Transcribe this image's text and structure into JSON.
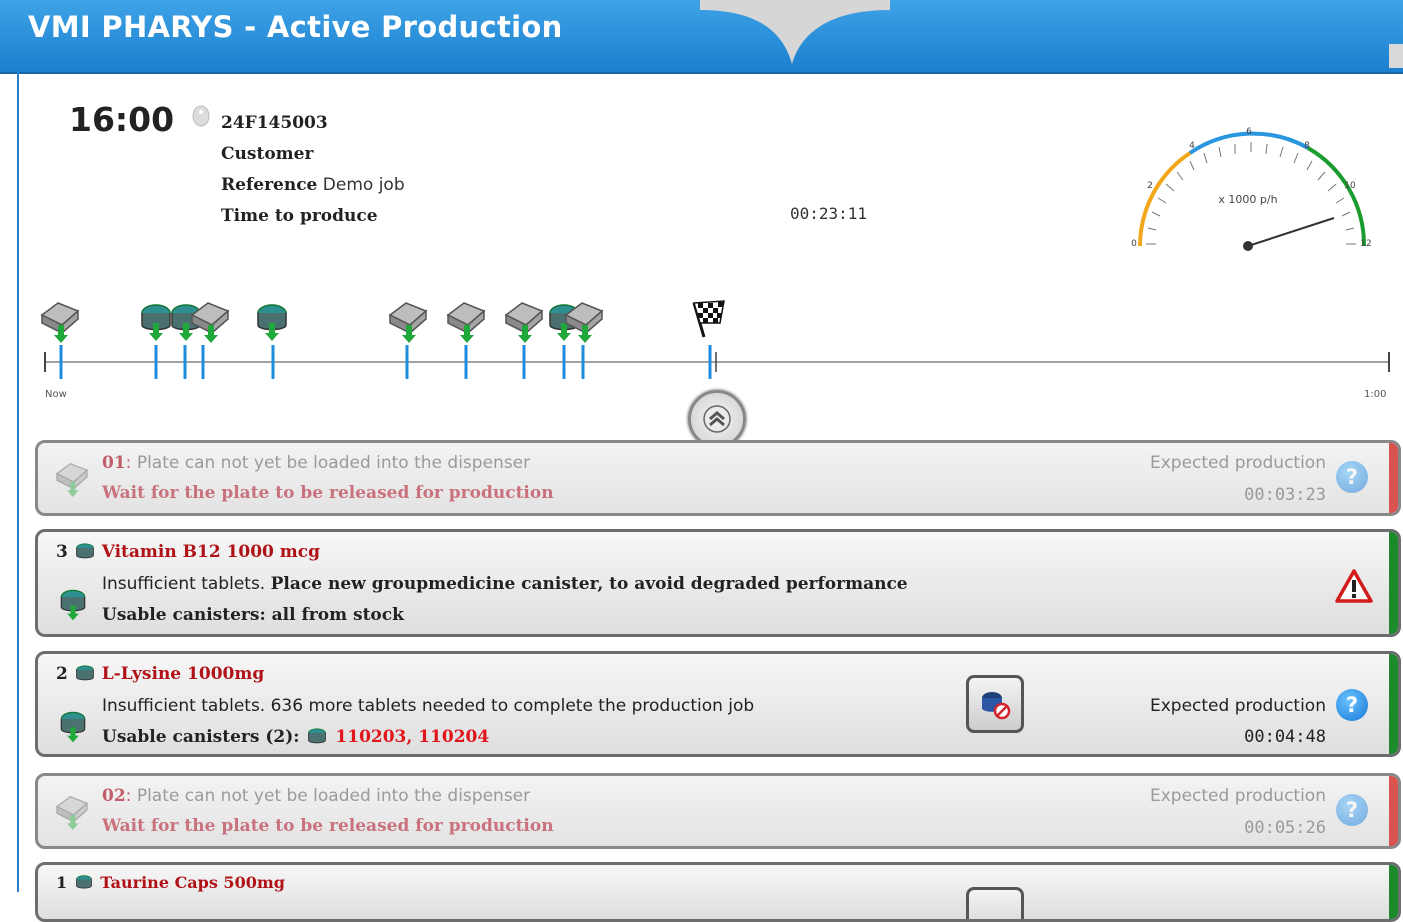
{
  "header": {
    "title": "VMI PHARYS - Active Production"
  },
  "job": {
    "clock": "16:00",
    "job_id": "24F145003",
    "customer_label": "Customer",
    "reference_label": "Reference",
    "reference_value": "Demo job",
    "time_to_produce_label": "Time to produce",
    "time_to_produce_value": "00:23:11"
  },
  "gauge": {
    "unit_label": "x 1000 p/h",
    "ticks": [
      "0",
      "2",
      "4",
      "6",
      "8",
      "10",
      "12"
    ],
    "value": 12,
    "colors": {
      "low": "#f2a61a",
      "mid": "#2b96e0",
      "high": "#1a9c2e"
    }
  },
  "timeline": {
    "start_label": "Now",
    "end_label": "1:00"
  },
  "cards": [
    {
      "number": "01",
      "line1": "Plate  can not yet be loaded into the dispenser",
      "line2": "Wait for the plate to be released for production",
      "expected_label": "Expected production",
      "expected_time": "00:03:23",
      "status_color": "#d9534f"
    },
    {
      "count": "3",
      "name": "Vitamin B12 1000 mcg",
      "line1_normal": "Insufficient tablets.",
      "line1_bold": "Place new groupmedicine canister, to avoid degraded performance",
      "line2": "Usable canisters: all from stock",
      "status_color": "#1a8a2a"
    },
    {
      "count": "2",
      "name": "L-Lysine 1000mg",
      "line1": "Insufficient tablets. 636 more tablets needed to complete the production job",
      "line2_label": "Usable canisters (2):",
      "line2_value": "110203, 110204",
      "expected_label": "Expected production",
      "expected_time": "00:04:48",
      "status_color": "#1a8a2a"
    },
    {
      "number": "02",
      "line1": "Plate  can not yet be loaded into the dispenser",
      "line2": "Wait for the plate to be released for production",
      "expected_label": "Expected production",
      "expected_time": "00:05:26",
      "status_color": "#d9534f"
    },
    {
      "count": "1",
      "name": "Taurine Caps 500mg",
      "status_color": "#1a8a2a"
    }
  ]
}
